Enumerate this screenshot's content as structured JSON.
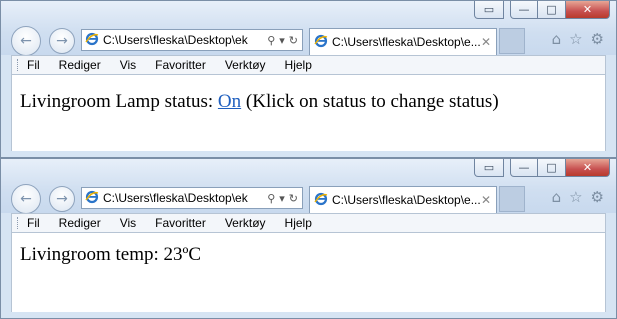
{
  "windows": [
    {
      "address": {
        "url": "C:\\Users\\fleska\\Desktop\\ek"
      },
      "tab": {
        "title": "C:\\Users\\fleska\\Desktop\\e..."
      },
      "menu": [
        "Fil",
        "Rediger",
        "Vis",
        "Favoritter",
        "Verktøy",
        "Hjelp"
      ],
      "content": {
        "prefix": "Livingroom Lamp status: ",
        "link": "On",
        "suffix": " (Klick on status to change status)"
      }
    },
    {
      "address": {
        "url": "C:\\Users\\fleska\\Desktop\\ek"
      },
      "tab": {
        "title": "C:\\Users\\fleska\\Desktop\\e..."
      },
      "menu": [
        "Fil",
        "Rediger",
        "Vis",
        "Favoritter",
        "Verktøy",
        "Hjelp"
      ],
      "content": {
        "text": "Livingroom temp: 23ºC"
      }
    }
  ],
  "icons": {
    "back": "back-arrow-icon",
    "forward": "forward-arrow-icon",
    "search": "search-icon",
    "refresh": "refresh-icon",
    "home": "home-icon",
    "favorites": "star-icon",
    "tools": "gear-icon",
    "close": "close-icon"
  },
  "colors": {
    "link": "#1f5fbf",
    "frame": "#d6e4f3",
    "close_button": "#c75050"
  }
}
